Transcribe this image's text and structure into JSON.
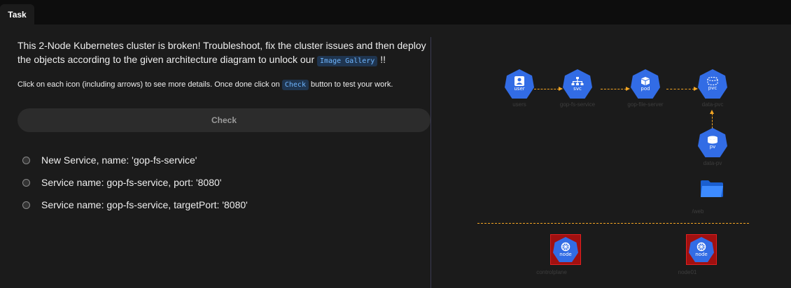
{
  "tab": {
    "label": "Task"
  },
  "intro": {
    "text_before": "This 2-Node Kubernetes cluster is broken! Troubleshoot, fix the cluster issues and then deploy the objects according to the given architecture diagram to unlock our ",
    "code": "Image Gallery",
    "text_after": " !!"
  },
  "hint": {
    "text_before": "Click on each icon (including arrows) to see more details. Once done click on ",
    "code": "Check",
    "text_after": " button to test your work."
  },
  "check_button": {
    "label": "Check"
  },
  "checklist": [
    "New Service, name: 'gop-fs-service'",
    "Service name: gop-fs-service, port: '8080'",
    "Service name: gop-fs-service, targetPort: '8080'"
  ],
  "diagram": {
    "nodes": {
      "users": {
        "tag": "user",
        "label": "users"
      },
      "svc": {
        "tag": "svc",
        "label": "gop-fs-service"
      },
      "pod": {
        "tag": "pod",
        "label": "gop-file-server"
      },
      "pvc": {
        "tag": "pvc",
        "label": "data-pvc"
      },
      "pv": {
        "tag": "pv",
        "label": "data-pv"
      },
      "folder": {
        "label": "/web"
      },
      "controlplane": {
        "tag": "node",
        "label": "controlplane"
      },
      "node01": {
        "tag": "node",
        "label": "node01"
      }
    },
    "colors": {
      "k8s_blue": "#326ce5",
      "arrow": "#f5a623",
      "node_red": "#a01010"
    }
  }
}
